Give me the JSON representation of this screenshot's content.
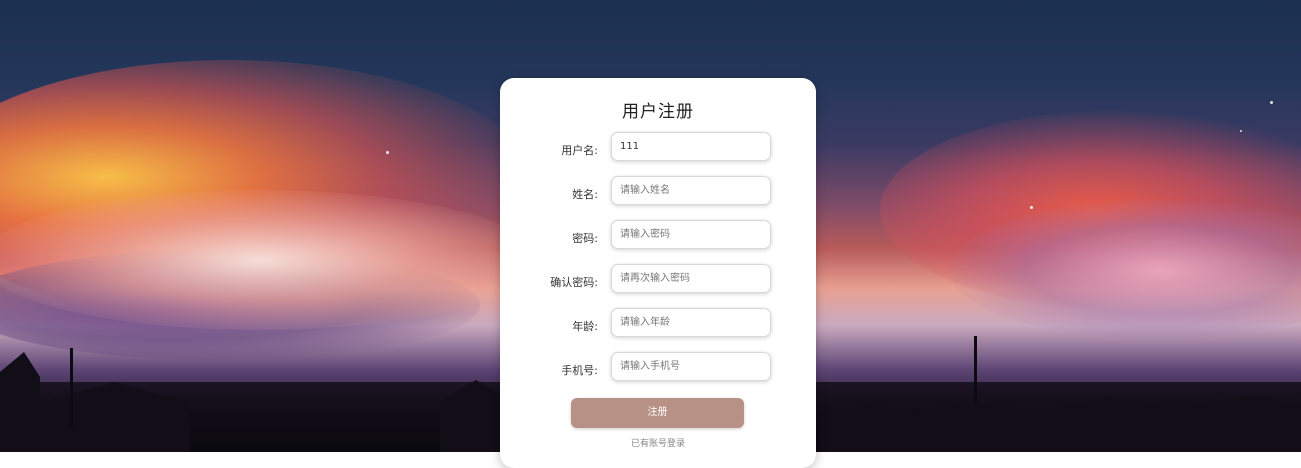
{
  "form": {
    "title": "用户注册",
    "fields": [
      {
        "label": "用户名:",
        "value": "111",
        "placeholder": ""
      },
      {
        "label": "姓名:",
        "value": "",
        "placeholder": "请输入姓名"
      },
      {
        "label": "密码:",
        "value": "",
        "placeholder": "请输入密码"
      },
      {
        "label": "确认密码:",
        "value": "",
        "placeholder": "请再次输入密码"
      },
      {
        "label": "年龄:",
        "value": "",
        "placeholder": "请输入年龄"
      },
      {
        "label": "手机号:",
        "value": "",
        "placeholder": "请输入手机号"
      }
    ],
    "submit_label": "注册",
    "login_link": "已有账号登录"
  },
  "colors": {
    "submit_button": "#b89186",
    "card_background": "#ffffff"
  }
}
